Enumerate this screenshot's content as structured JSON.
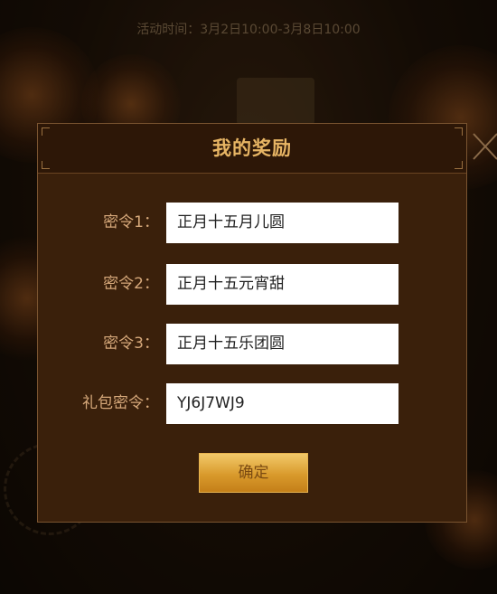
{
  "header": {
    "activity_time": "活动时间：3月2日10:00-3月8日10:00"
  },
  "dialog": {
    "title": "我的奖励",
    "rows": [
      {
        "label": "密令1：",
        "value": "正月十五月儿圆"
      },
      {
        "label": "密令2：",
        "value": "正月十五元宵甜"
      },
      {
        "label": "密令3：",
        "value": "正月十五乐团圆"
      },
      {
        "label": "礼包密令：",
        "value": "YJ6J7WJ9"
      }
    ],
    "confirm_label": "确定"
  },
  "icons": {
    "close": "close-icon"
  },
  "colors": {
    "title_gold": "#e7b564",
    "label_tan": "#d6a87a",
    "dialog_bg": "#3a200b",
    "button_gold": "#d99a2c"
  }
}
